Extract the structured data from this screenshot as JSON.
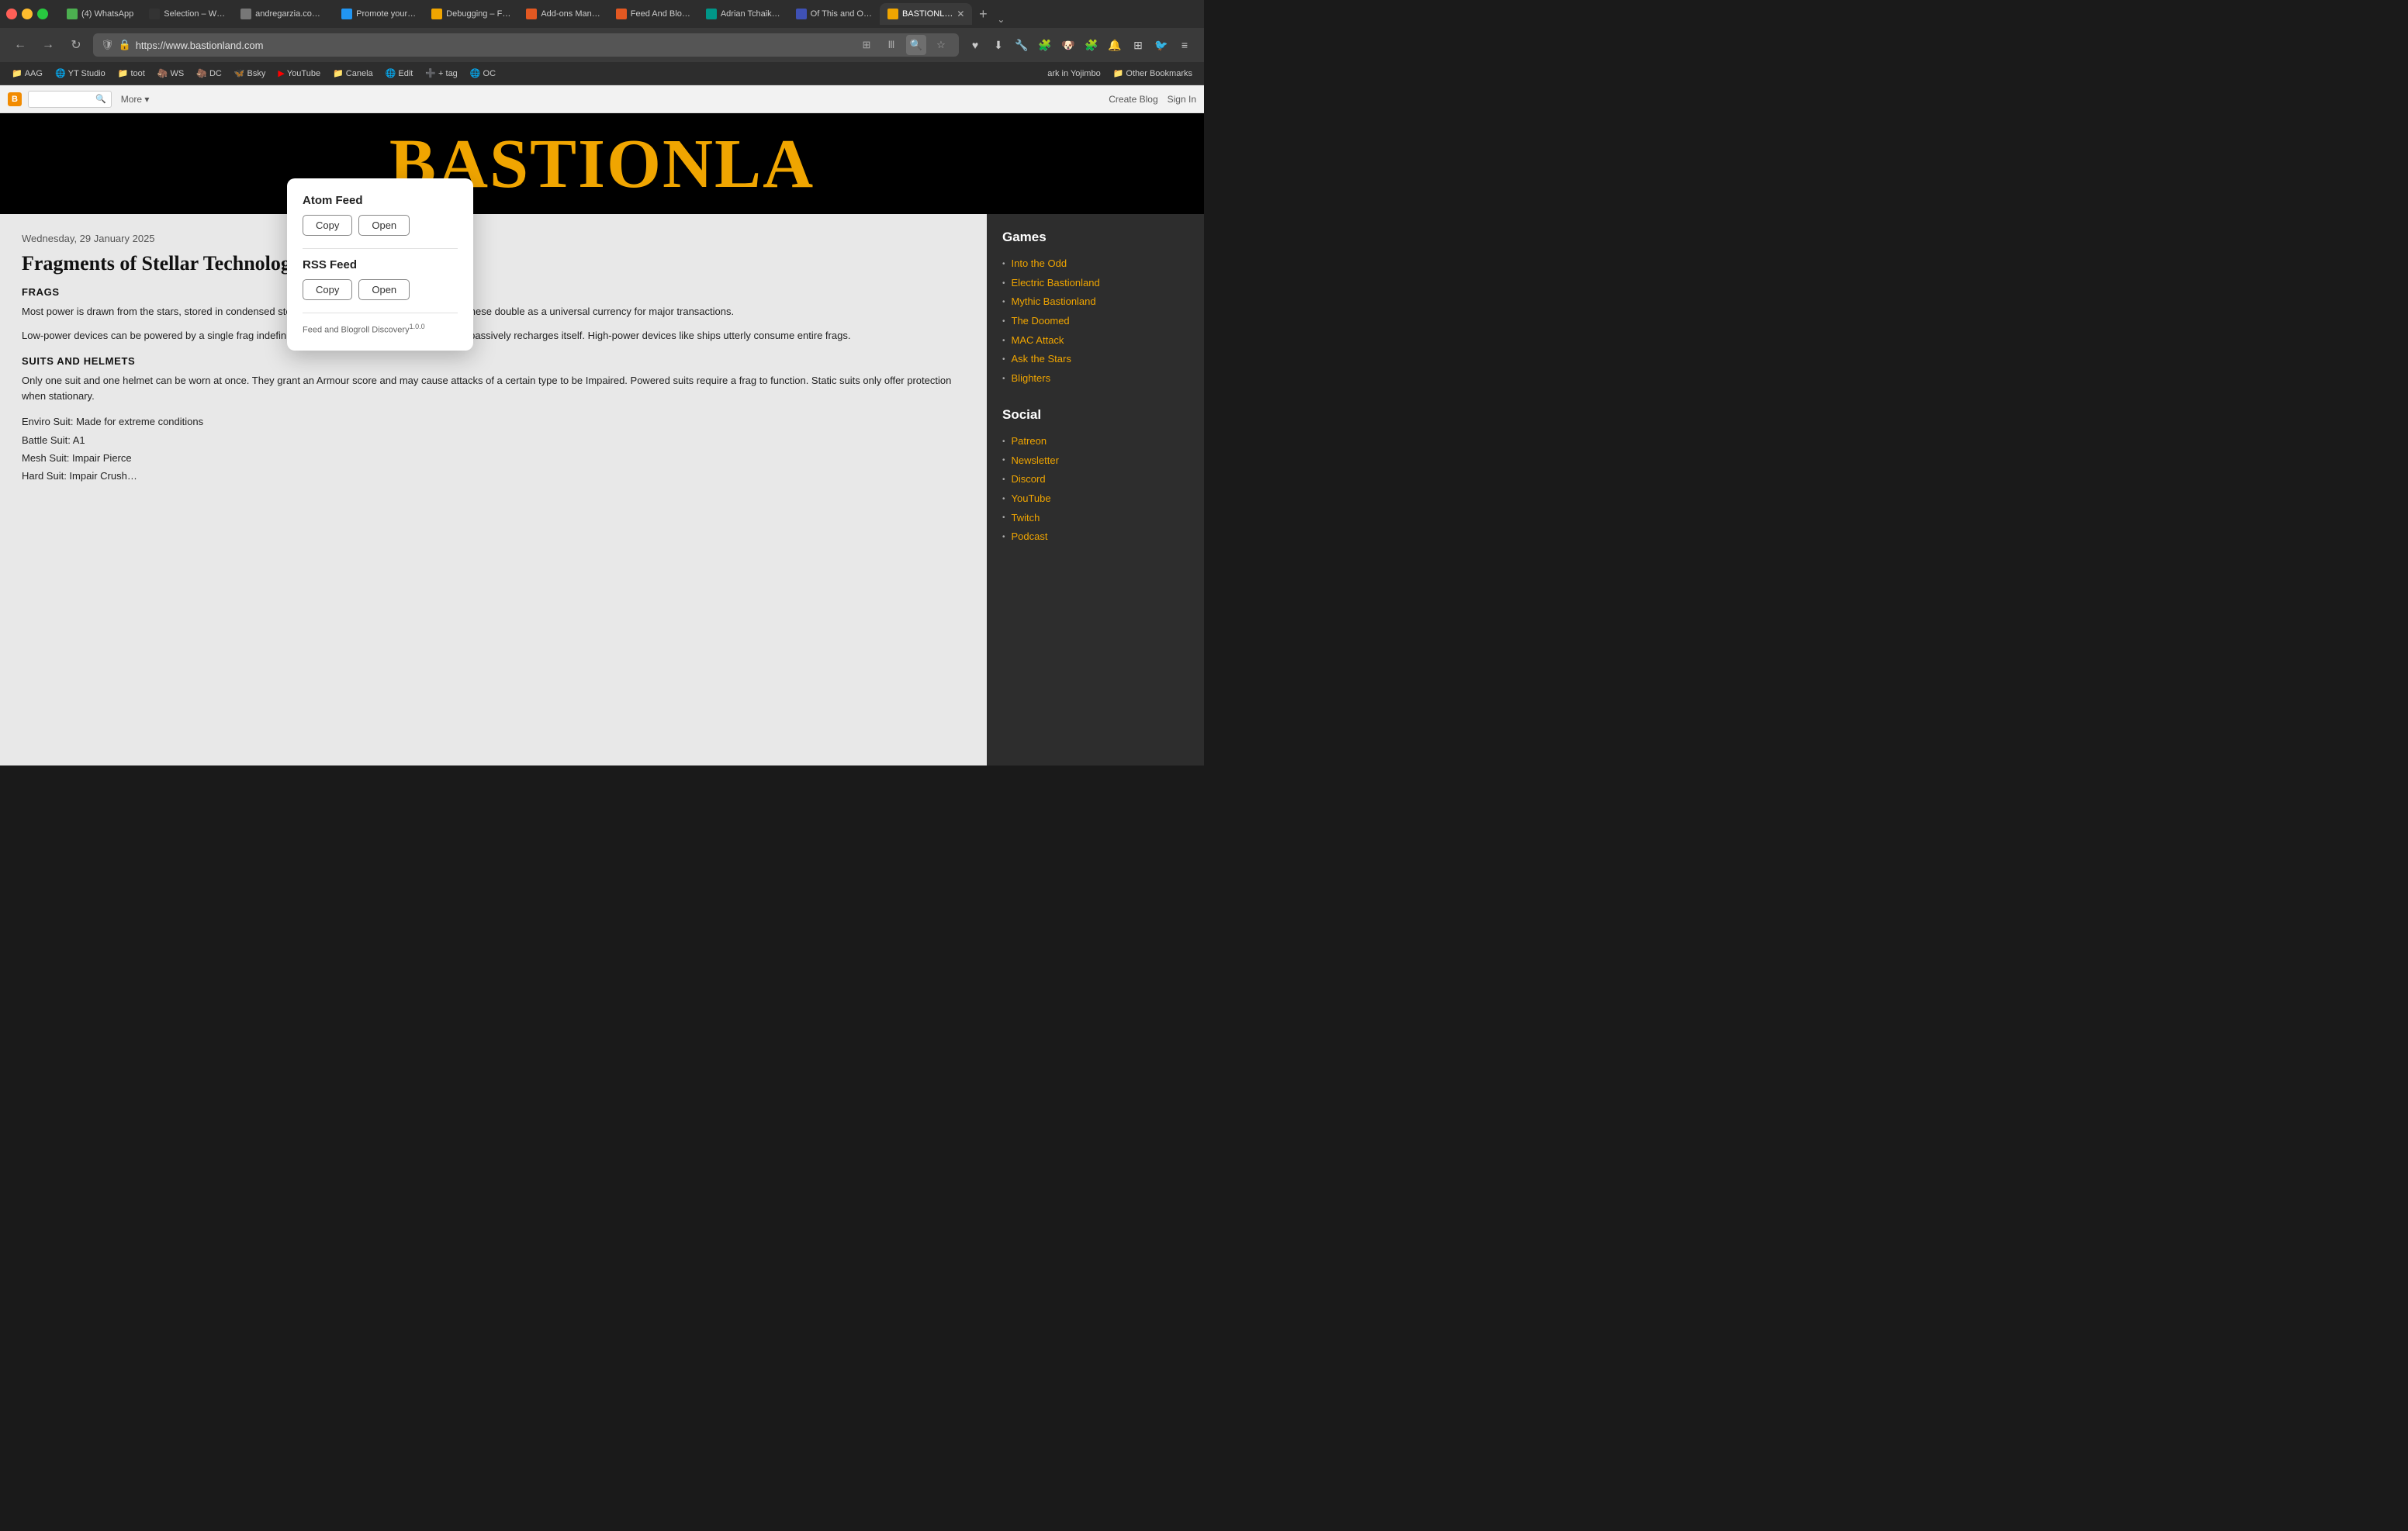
{
  "browser": {
    "tabs": [
      {
        "id": "tab-whatsapp",
        "label": "(4) WhatsApp",
        "favicon_color": "fav-green",
        "active": false
      },
      {
        "id": "tab-selection",
        "label": "Selection – W…",
        "favicon_color": "fav-dark",
        "active": false
      },
      {
        "id": "tab-andregarzia",
        "label": "andregarzia.com/…",
        "favicon_color": "fav-gray",
        "active": false
      },
      {
        "id": "tab-promote",
        "label": "Promote your…",
        "favicon_color": "fav-blue",
        "active": false
      },
      {
        "id": "tab-debugging",
        "label": "Debugging – F…",
        "favicon_color": "fav-orange",
        "active": false
      },
      {
        "id": "tab-addons",
        "label": "Add-ons Man…",
        "favicon_color": "fav-firefox",
        "active": false
      },
      {
        "id": "tab-feed-blog",
        "label": "Feed And Blo…",
        "favicon_color": "fav-firefox",
        "active": false
      },
      {
        "id": "tab-adrian",
        "label": "Adrian Tchaik…",
        "favicon_color": "fav-teal",
        "active": false
      },
      {
        "id": "tab-ofthis",
        "label": "Of This and O…",
        "favicon_color": "fav-indigo",
        "active": false
      },
      {
        "id": "tab-bastionland",
        "label": "BASTIONL…",
        "favicon_color": "fav-orange",
        "active": true
      }
    ],
    "url": "https://www.bastionland.com",
    "new_tab_label": "+",
    "chevron_label": "⌄"
  },
  "bookmarks": [
    {
      "label": "AAG",
      "icon": "📁"
    },
    {
      "label": "YT Studio",
      "icon": "🌐"
    },
    {
      "label": "toot",
      "icon": "📁"
    },
    {
      "label": "WS",
      "icon": "🦣"
    },
    {
      "label": "DC",
      "icon": "🦣"
    },
    {
      "label": "Bsky",
      "icon": "🦋"
    },
    {
      "label": "YouTube",
      "icon": "▶"
    },
    {
      "label": "Canela",
      "icon": "📁"
    },
    {
      "label": "Edit",
      "icon": "🌐"
    },
    {
      "label": "+ tag",
      "icon": "➕"
    },
    {
      "label": "OC",
      "icon": "🌐"
    }
  ],
  "bookmarks_right": {
    "label": "ark in Yojimbo",
    "other": "Other Bookmarks"
  },
  "blogger": {
    "search_placeholder": "",
    "more_label": "More",
    "more_chevron": "▾",
    "right_links": [
      "Create Blog",
      "Sign In"
    ]
  },
  "site": {
    "title": "BASTIONLA",
    "url": "https://www.bastionland.com"
  },
  "article": {
    "date": "Wednesday, 29 January 2025",
    "title": "Fragments of Stellar Technology",
    "section1": "FRAGS",
    "para1": "Most power is drawn from the stars, stored in condensed stellar fragments, commonly called frags. These double as a universal currency for major transactions.",
    "para2": "Low-power devices can be powered by a single frag indefinitely, consuming its energy slower than it passively recharges itself. High-power devices like ships utterly consume entire frags.",
    "section2": "SUITS AND HELMETS",
    "para3": "Only one suit and one helmet can be worn at once. They grant an Armour score and may cause attacks of a certain type to be Impaired. Powered suits require a frag to function. Static suits only offer protection when stationary.",
    "list_items": [
      "Enviro Suit: Made for extreme conditions",
      "Battle Suit: A1",
      "Mesh Suit: Impair Pierce",
      "Hard Suit: Impair Crush…"
    ]
  },
  "sidebar": {
    "games_title": "Games",
    "games_links": [
      "Into the Odd",
      "Electric Bastionland",
      "Mythic Bastionland",
      "The Doomed",
      "MAC Attack",
      "Ask the Stars",
      "Blighters"
    ],
    "social_title": "Social",
    "social_links": [
      "Patreon",
      "Newsletter",
      "Discord",
      "YouTube",
      "Twitch",
      "Podcast"
    ]
  },
  "feed_popup": {
    "atom_title": "Atom Feed",
    "atom_copy": "Copy",
    "atom_open": "Open",
    "rss_title": "RSS Feed",
    "rss_copy": "Copy",
    "rss_open": "Open",
    "footer": "Feed and Blogroll Discovery",
    "footer_version": "1.0.0"
  },
  "icons": {
    "back": "←",
    "forward": "→",
    "reload": "↻",
    "shield": "🛡",
    "lock": "🔒",
    "star": "☆",
    "grid": "⊞",
    "dots_menu": "⋮",
    "search": "🔍",
    "download": "⬇",
    "wrench": "🔧",
    "puzzle": "🧩",
    "extensions": "🧩",
    "menu": "≡"
  }
}
